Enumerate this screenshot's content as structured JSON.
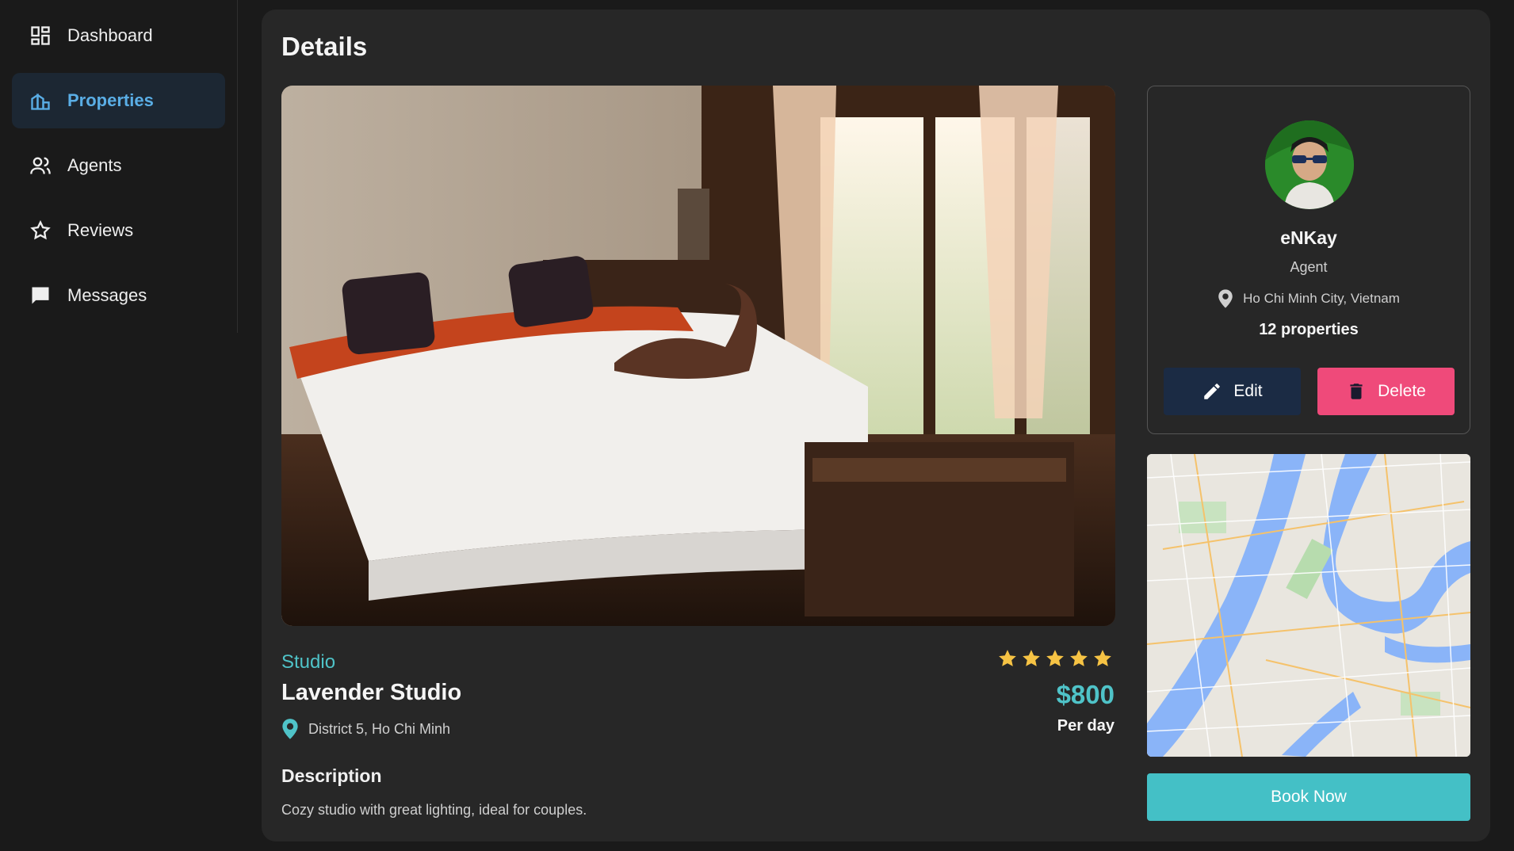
{
  "sidebar": {
    "items": [
      {
        "label": "Dashboard",
        "icon": "dashboard-icon",
        "active": false
      },
      {
        "label": "Properties",
        "icon": "properties-icon",
        "active": true
      },
      {
        "label": "Agents",
        "icon": "agents-icon",
        "active": false
      },
      {
        "label": "Reviews",
        "icon": "star-outline-icon",
        "active": false
      },
      {
        "label": "Messages",
        "icon": "message-icon",
        "active": false
      }
    ]
  },
  "page": {
    "title": "Details"
  },
  "property": {
    "type": "Studio",
    "name": "Lavender Studio",
    "location": "District 5, Ho Chi Minh",
    "rating": 5,
    "rating_max": 5,
    "price": "$800",
    "price_unit": "Per day",
    "description_title": "Description",
    "description": "Cozy studio with great lighting, ideal for couples."
  },
  "agent": {
    "name": "eNKay",
    "role": "Agent",
    "location": "Ho Chi Minh City, Vietnam",
    "properties": "12 properties",
    "edit_label": "Edit",
    "delete_label": "Delete"
  },
  "actions": {
    "book_label": "Book Now"
  },
  "colors": {
    "accent": "#4fc3c8",
    "active_nav": "#5aaee6",
    "delete": "#ef4a7a",
    "edit": "#1b2b44",
    "star": "#f6c344"
  }
}
